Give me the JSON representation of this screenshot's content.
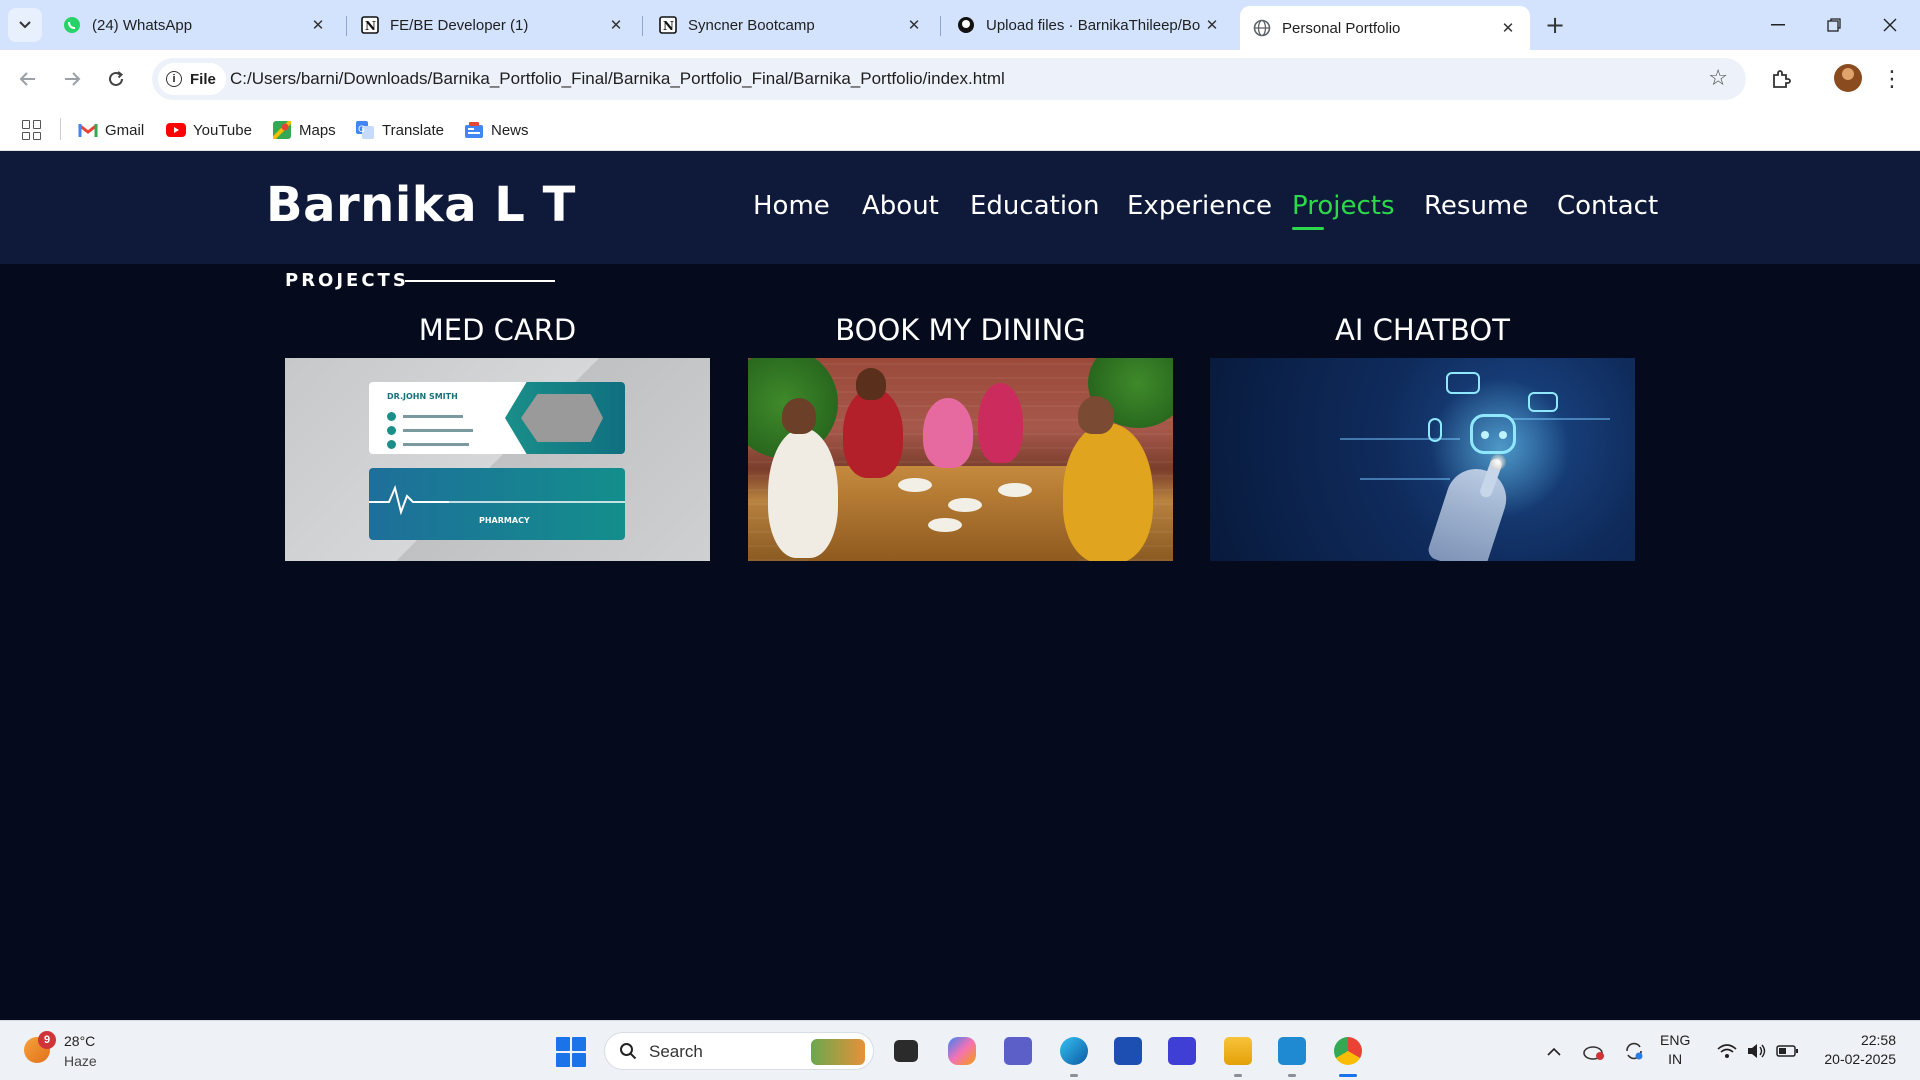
{
  "browser": {
    "tabs": [
      {
        "label": "(24) WhatsApp",
        "icon": "whatsapp-icon"
      },
      {
        "label": "FE/BE Developer (1)",
        "icon": "notion-icon"
      },
      {
        "label": "Syncner Bootcamp",
        "icon": "notion-icon"
      },
      {
        "label": "Upload files · BarnikaThileep/Bo",
        "icon": "github-icon"
      },
      {
        "label": "Personal Portfolio",
        "icon": "globe-icon",
        "active": true
      }
    ],
    "address": {
      "scheme_chip": "File",
      "url": "C:/Users/barni/Downloads/Barnika_Portfolio_Final/Barnika_Portfolio_Final/Barnika_Portfolio/index.html"
    },
    "bookmarks": [
      {
        "label": "Gmail",
        "icon": "gmail-icon"
      },
      {
        "label": "YouTube",
        "icon": "youtube-icon"
      },
      {
        "label": "Maps",
        "icon": "maps-icon"
      },
      {
        "label": "Translate",
        "icon": "translate-icon"
      },
      {
        "label": "News",
        "icon": "news-icon"
      }
    ]
  },
  "site": {
    "logo": "Barnika L T",
    "nav": [
      {
        "label": "Home"
      },
      {
        "label": "About"
      },
      {
        "label": "Education"
      },
      {
        "label": "Experience"
      },
      {
        "label": "Projects",
        "active": true
      },
      {
        "label": "Resume"
      },
      {
        "label": "Contact"
      }
    ],
    "section_label": "PROJECTS",
    "projects": [
      {
        "title": "MED CARD",
        "image": "business-card-image",
        "card_name": "DR.JOHN SMITH",
        "card2_text": "PHARMACY"
      },
      {
        "title": "BOOK MY DINING",
        "image": "family-dining-image"
      },
      {
        "title": "AI CHATBOT",
        "image": "robot-hand-image"
      }
    ],
    "colors": {
      "header_bg": "#0f1a3a",
      "page_bg": "#050b1d",
      "accent": "#2bd94a"
    }
  },
  "taskbar": {
    "weather": {
      "temp": "28°C",
      "desc": "Haze",
      "badge": "9"
    },
    "search_placeholder": "Search",
    "language": {
      "line1": "ENG",
      "line2": "IN"
    },
    "clock": {
      "time": "22:58",
      "date": "20-02-2025"
    }
  }
}
